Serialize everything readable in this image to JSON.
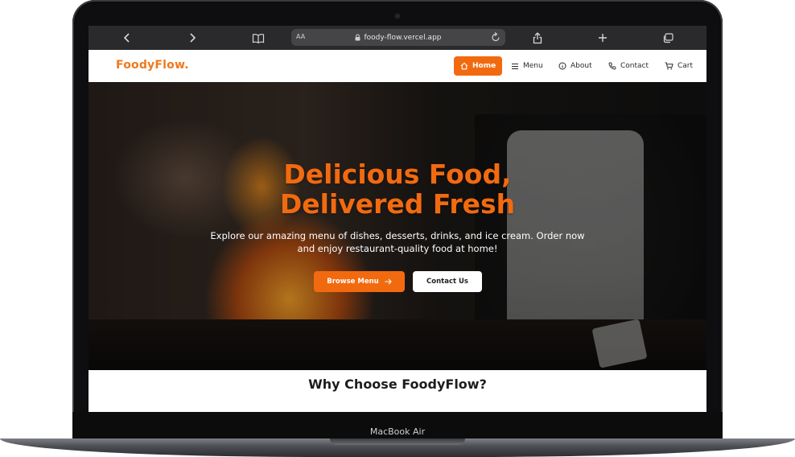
{
  "device": {
    "label": "MacBook Air"
  },
  "browser": {
    "text_size_label": "AA",
    "url": "foody-flow.vercel.app",
    "icons": [
      "back-icon",
      "forward-icon",
      "book-icon",
      "lock-icon",
      "reload-icon",
      "share-icon",
      "plus-icon",
      "tabs-icon"
    ]
  },
  "nav": {
    "brand": "FoodyFlow.",
    "items": [
      {
        "label": "Home",
        "icon": "home-icon",
        "active": true
      },
      {
        "label": "Menu",
        "icon": "menu-icon",
        "active": false
      },
      {
        "label": "About",
        "icon": "info-icon",
        "active": false
      },
      {
        "label": "Contact",
        "icon": "phone-icon",
        "active": false
      },
      {
        "label": "Cart",
        "icon": "cart-icon",
        "active": false
      }
    ]
  },
  "hero": {
    "title_line1": "Delicious Food,",
    "title_line2": "Delivered Fresh",
    "subtitle": "Explore our amazing menu of dishes, desserts, drinks, and ice cream. Order now and enjoy restaurant-quality food at home!",
    "primary_button": "Browse Menu",
    "secondary_button": "Contact Us"
  },
  "section": {
    "title": "Why Choose FoodyFlow?"
  },
  "colors": {
    "accent": "#f26a10",
    "brand": "#f0781e",
    "browser_bar": "#2a2a2d"
  }
}
